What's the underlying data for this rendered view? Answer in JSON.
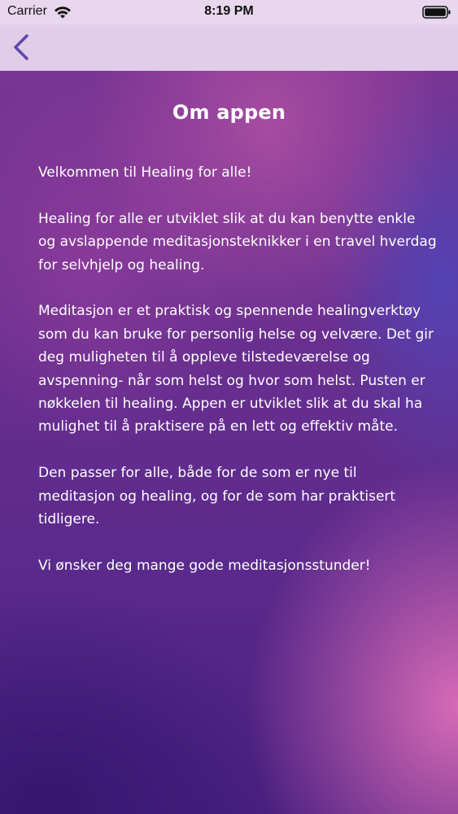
{
  "status_bar": {
    "carrier": "Carrier",
    "time": "8:19 PM",
    "icons": [
      "wifi-icon",
      "battery-icon"
    ]
  },
  "nav_bar": {
    "back_icon": "chevron-left-icon",
    "accent_color": "#5b4aa8"
  },
  "page": {
    "title": "Om appen",
    "paragraphs": [
      "Velkommen til Healing for alle!",
      "Healing for alle  er utviklet slik at du kan benytte enkle og avslappende meditasjonsteknikker i en travel hverdag for selvhjelp og healing.",
      "Meditasjon er et praktisk og spennende healingverktøy som du kan bruke for personlig helse og velvære. Det gir deg muligheten til å oppleve tilstedeværelse og avspenning- når som helst og hvor som helst. Pusten er nøkkelen til healing. Appen er utviklet slik at du skal ha mulighet til å praktisere på en lett og effektiv måte.",
      "Den passer for alle, både for de som er nye til meditasjon og healing, og for de som har praktisert tidligere.",
      "Vi ønsker deg mange gode meditasjonsstunder!"
    ]
  },
  "colors": {
    "status_bar_bg": "#e8d7ee",
    "nav_bar_bg": "#e1cde9",
    "text": "#ffffff",
    "background_purple": "#6a2f8f",
    "background_pink": "#de6eb9"
  }
}
